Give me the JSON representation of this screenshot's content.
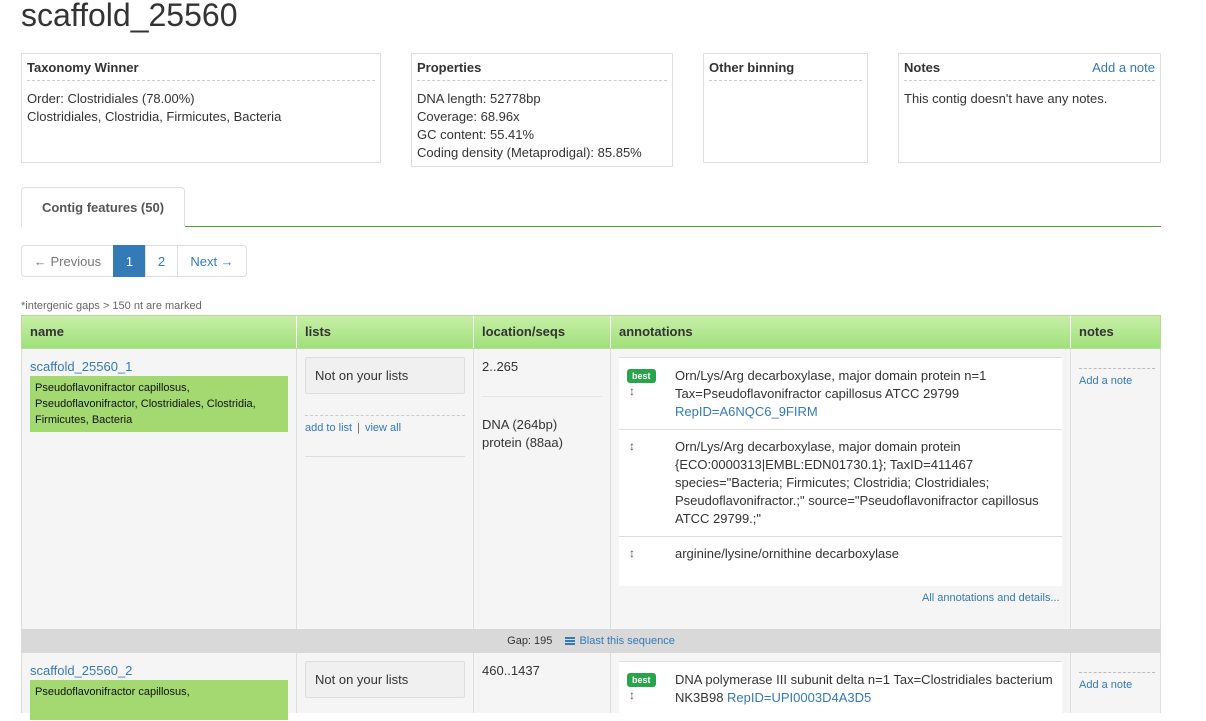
{
  "page": {
    "title": "scaffold_25560"
  },
  "taxonomy": {
    "heading": "Taxonomy Winner",
    "order": "Order: Clostridiales (78.00%)",
    "lineage": "Clostridiales, Clostridia, Firmicutes, Bacteria"
  },
  "properties": {
    "heading": "Properties",
    "dna_length": "DNA length: 52778bp",
    "coverage": "Coverage: 68.96x",
    "gc": "GC content: 55.41%",
    "coding": "Coding density (Metaprodigal): 85.85%"
  },
  "binning": {
    "heading": "Other binning"
  },
  "notes": {
    "heading": "Notes",
    "add": "Add a note",
    "empty": "This contig doesn't have any notes."
  },
  "tab": {
    "label": "Contig features (50)"
  },
  "pager": {
    "prev": "← Previous",
    "pages": [
      "1",
      "2"
    ],
    "next": "Next →",
    "active": "1"
  },
  "gap_note": "*intergenic gaps > 150 nt are marked",
  "table": {
    "headers": [
      "name",
      "lists",
      "location/seqs",
      "annotations",
      "notes"
    ],
    "rows": [
      {
        "name": "scaffold_25560_1",
        "taxonomy": "Pseudoflavonifractor capillosus, Pseudoflavonifractor, Clostridiales, Clostridia, Firmicutes, Bacteria",
        "list_status": "Not on your lists",
        "add_to_list": "add to list",
        "list_sep": "|",
        "view_all": "view all",
        "location": "2..265",
        "dna": "DNA (264bp)",
        "protein": "protein (88aa)",
        "annotations": [
          {
            "best": "best",
            "text": "Orn/Lys/Arg decarboxylase, major domain protein n=1 Tax=Pseudoflavonifractor capillosus ATCC 29799",
            "link": "RepID=A6NQC6_9FIRM"
          },
          {
            "text": "Orn/Lys/Arg decarboxylase, major domain protein {ECO:0000313|EMBL:EDN01730.1}; TaxID=411467 species=\"Bacteria; Firmicutes; Clostridia; Clostridiales; Pseudoflavonifractor.;\" source=\"Pseudoflavonifractor capillosus ATCC 29799.;\""
          },
          {
            "text": "arginine/lysine/ornithine decarboxylase"
          }
        ],
        "all_annotations": "All annotations and details...",
        "add_note": "Add a note"
      },
      {
        "name": "scaffold_25560_2",
        "taxonomy": "Pseudoflavonifractor capillosus,",
        "list_status": "Not on your lists",
        "location": "460..1437",
        "annotations": [
          {
            "best": "best",
            "text": "DNA polymerase III subunit delta n=1 Tax=Clostridiales bacterium",
            "text2": "NK3B98",
            "link": "RepID=UPI0003D4A3D5"
          }
        ],
        "add_note": "Add a note"
      }
    ],
    "gap": {
      "label": "Gap: 195",
      "blast": "Blast this sequence"
    }
  },
  "icons": {
    "sort": "sort-arrows-icon",
    "blast": "blast-list-icon"
  },
  "colors": {
    "header_green": "#9fe07a",
    "tax_green": "#a4d870",
    "badge_green": "#2aa44a",
    "link": "#337ab7"
  }
}
